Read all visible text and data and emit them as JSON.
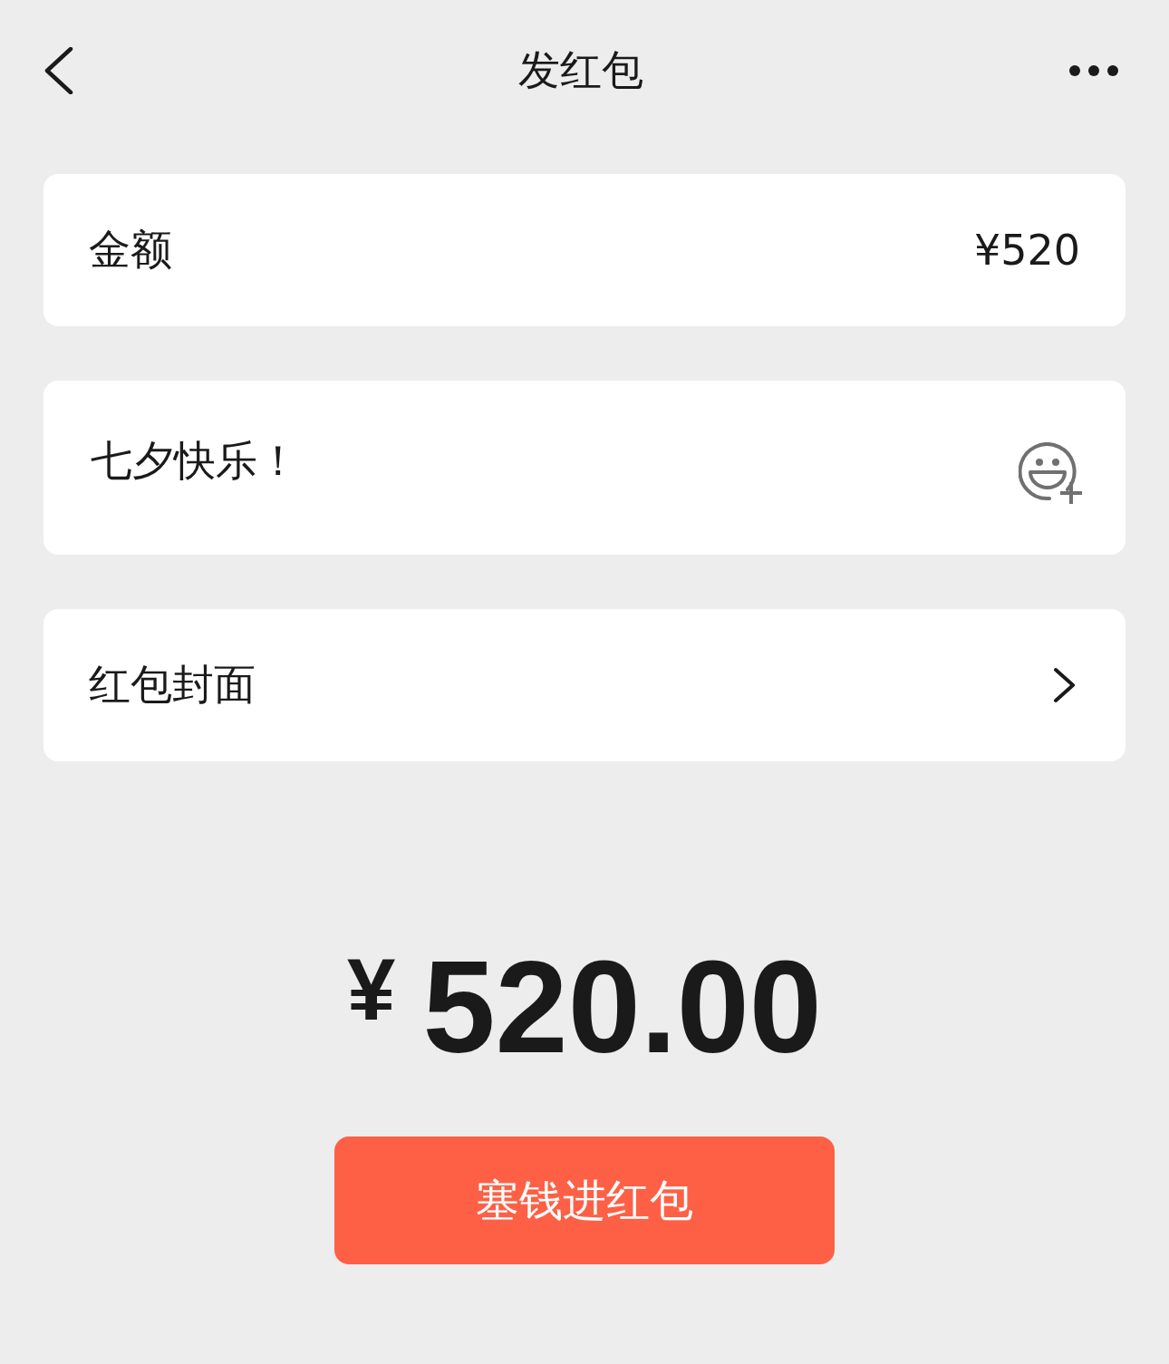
{
  "header": {
    "title": "发红包"
  },
  "amount_row": {
    "label": "金额",
    "value": "¥520"
  },
  "greeting": {
    "value": "七夕快乐！"
  },
  "cover_row": {
    "label": "红包封面"
  },
  "total": {
    "currency": "¥",
    "amount": "520.00"
  },
  "submit_button": {
    "label": "塞钱进红包"
  }
}
